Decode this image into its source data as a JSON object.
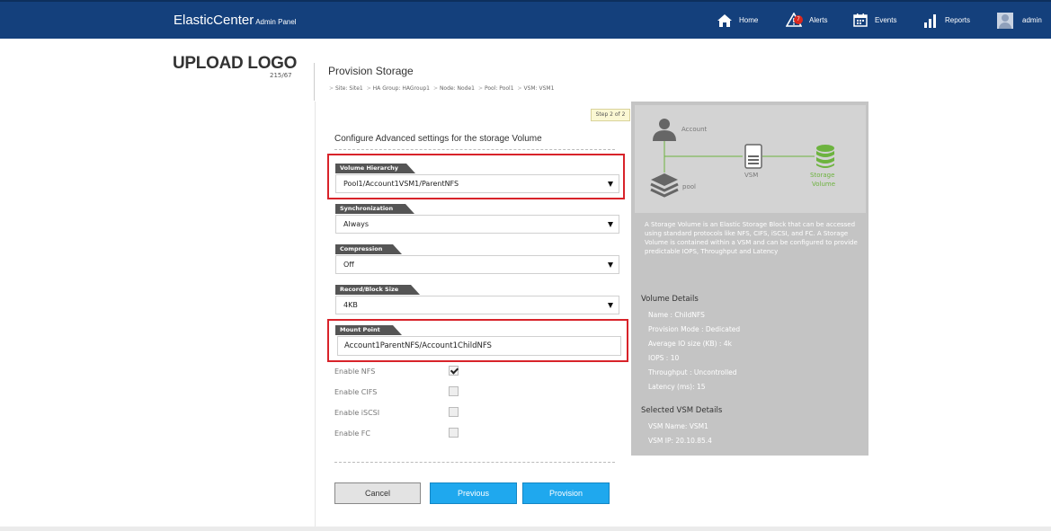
{
  "header": {
    "brand": "ElasticCenter",
    "brand_sub": "Admin Panel",
    "nav": {
      "home": "Home",
      "alerts": "Alerts",
      "alerts_count": "7",
      "events": "Events",
      "reports": "Reports",
      "user": "admin"
    }
  },
  "logo": {
    "title": "UPLOAD LOGO",
    "size": "215/67"
  },
  "page": {
    "title": "Provision Storage",
    "breadcrumb": [
      "Site: Site1",
      "HA Group: HAGroup1",
      "Node: Node1",
      "Pool: Pool1",
      "VSM: VSM1"
    ],
    "step": "Step 2 of 2"
  },
  "form": {
    "section_title": "Configure Advanced settings for the storage Volume",
    "volume_hierarchy": {
      "label": "Volume Hierarchy",
      "value": "Pool1/Account1VSM1/ParentNFS"
    },
    "synchronization": {
      "label": "Synchronization",
      "value": "Always"
    },
    "compression": {
      "label": "Compression",
      "value": "Off"
    },
    "block_size": {
      "label": "Record/Block Size",
      "value": "4KB"
    },
    "mount_point": {
      "label": "Mount Point",
      "value": "Account1ParentNFS/Account1ChildNFS"
    },
    "checkboxes": [
      {
        "label": "Enable NFS",
        "checked": true
      },
      {
        "label": "Enable CIFS",
        "checked": false
      },
      {
        "label": "Enable iSCSI",
        "checked": false
      },
      {
        "label": "Enable FC",
        "checked": false
      }
    ],
    "buttons": {
      "cancel": "Cancel",
      "previous": "Previous",
      "provision": "Provision"
    }
  },
  "side": {
    "diagram": {
      "account": "Account",
      "pool": "pool",
      "vsm": "VSM",
      "storage_volume_1": "Storage",
      "storage_volume_2": "Volume"
    },
    "description": "A Storage Volume is an Elastic Storage Block that can be accessed using standard protocols like NFS, CIFS, iSCSI, and FC. A Storage Volume is contained within a VSM and can be configured to provide predictable IOPS, Throughput and Latency",
    "volume_details": {
      "heading": "Volume Details",
      "items": [
        "Name : ChildNFS",
        "Provision Mode : Dedicated",
        "Average IO size (KB) : 4k",
        "IOPS : 10",
        "Throughput : Uncontrolled",
        "Latency (ms): 15"
      ]
    },
    "vsm_details": {
      "heading": "Selected VSM Details",
      "items": [
        "VSM Name: VSM1",
        "VSM IP: 20.10.85.4"
      ]
    }
  },
  "colors": {
    "header_bg": "#14407c",
    "accent_button": "#1fa8ee",
    "highlight": "#d8232a",
    "storage_green": "#6db33f"
  }
}
